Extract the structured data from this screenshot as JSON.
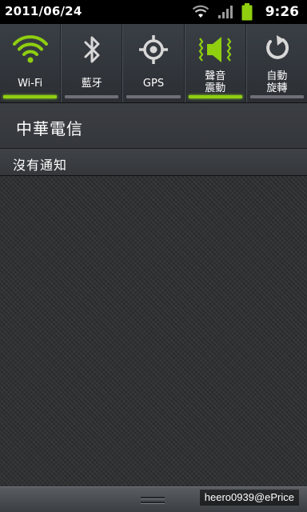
{
  "status_bar": {
    "date": "2011/06/24",
    "time": "9:26",
    "icons": [
      "wifi-signal-icon",
      "cell-signal-icon",
      "battery-icon"
    ]
  },
  "toggles": [
    {
      "label": "Wi-Fi",
      "icon": "wifi-icon",
      "enabled": true
    },
    {
      "label": "藍牙",
      "icon": "bluetooth-icon",
      "enabled": false
    },
    {
      "label": "GPS",
      "icon": "gps-icon",
      "enabled": false
    },
    {
      "label_line1": "聲音",
      "label_line2": "震動",
      "icon": "sound-vibrate-icon",
      "enabled": true
    },
    {
      "label_line1": "自動",
      "label_line2": "旋轉",
      "icon": "auto-rotate-icon",
      "enabled": false
    }
  ],
  "carrier": "中華電信",
  "notifications_header": "沒有通知",
  "watermark": "heero0939@ePrice",
  "colors": {
    "accent_green": "#8fcf10",
    "background": "#2c2f30",
    "battery": "#8fcf10"
  }
}
